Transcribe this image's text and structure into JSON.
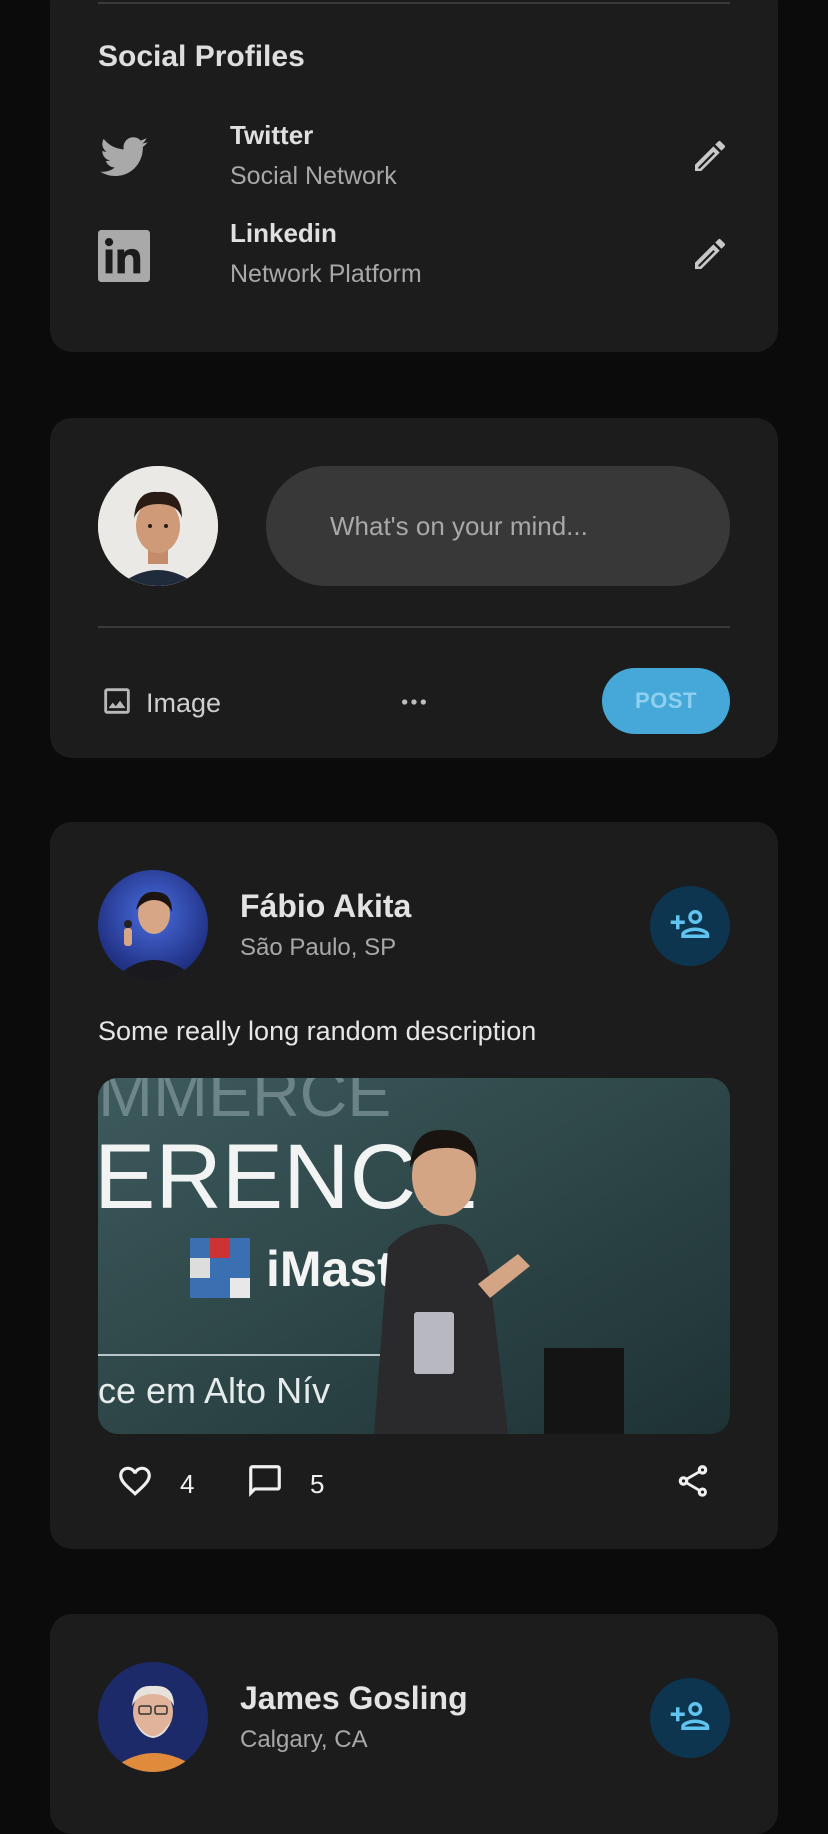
{
  "social_profiles": {
    "title": "Social Profiles",
    "items": [
      {
        "name": "Twitter",
        "subtitle": "Social Network",
        "icon": "twitter-icon"
      },
      {
        "name": "Linkedin",
        "subtitle": "Network Platform",
        "icon": "linkedin-icon"
      }
    ]
  },
  "composer": {
    "placeholder": "What's on your mind...",
    "image_label": "Image",
    "more_icon": "more-horizontal-icon",
    "post_label": "POST"
  },
  "posts": [
    {
      "author": "Fábio Akita",
      "location": "São Paulo, SP",
      "description": "Some really long random description",
      "likes": "4",
      "comments": "5",
      "image_caption": "Speaker on stage in front of a conference banner"
    },
    {
      "author": "James Gosling",
      "location": "Calgary, CA"
    }
  ],
  "colors": {
    "background": "#0b0b0b",
    "card": "#1c1c1c",
    "accent": "#45a8d8",
    "follow_bg": "#0d3550",
    "follow_icon": "#5fc4ef"
  }
}
